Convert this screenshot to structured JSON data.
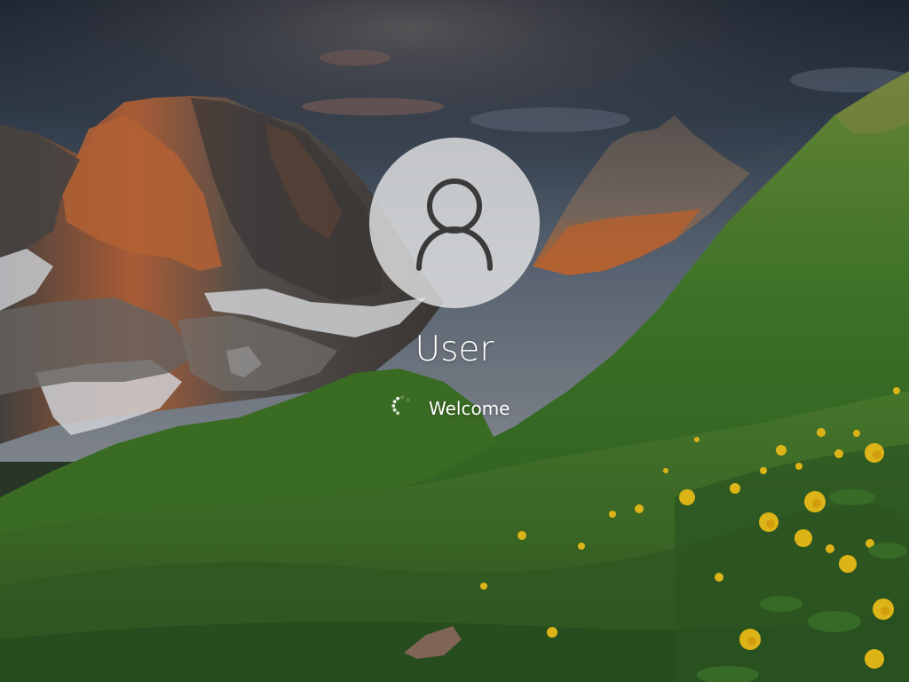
{
  "lockscreen": {
    "user_name": "User",
    "status_text": "Welcome",
    "avatar_icon": "user-silhouette-icon",
    "spinner_icon": "loading-spinner-icon"
  },
  "wallpaper": {
    "description_colors": {
      "sky": "#3b4656",
      "grass": "#4f8a2f",
      "flowers": "#f2c318",
      "rock": "#6a6460",
      "sunlit_rock": "#c86a35"
    }
  }
}
